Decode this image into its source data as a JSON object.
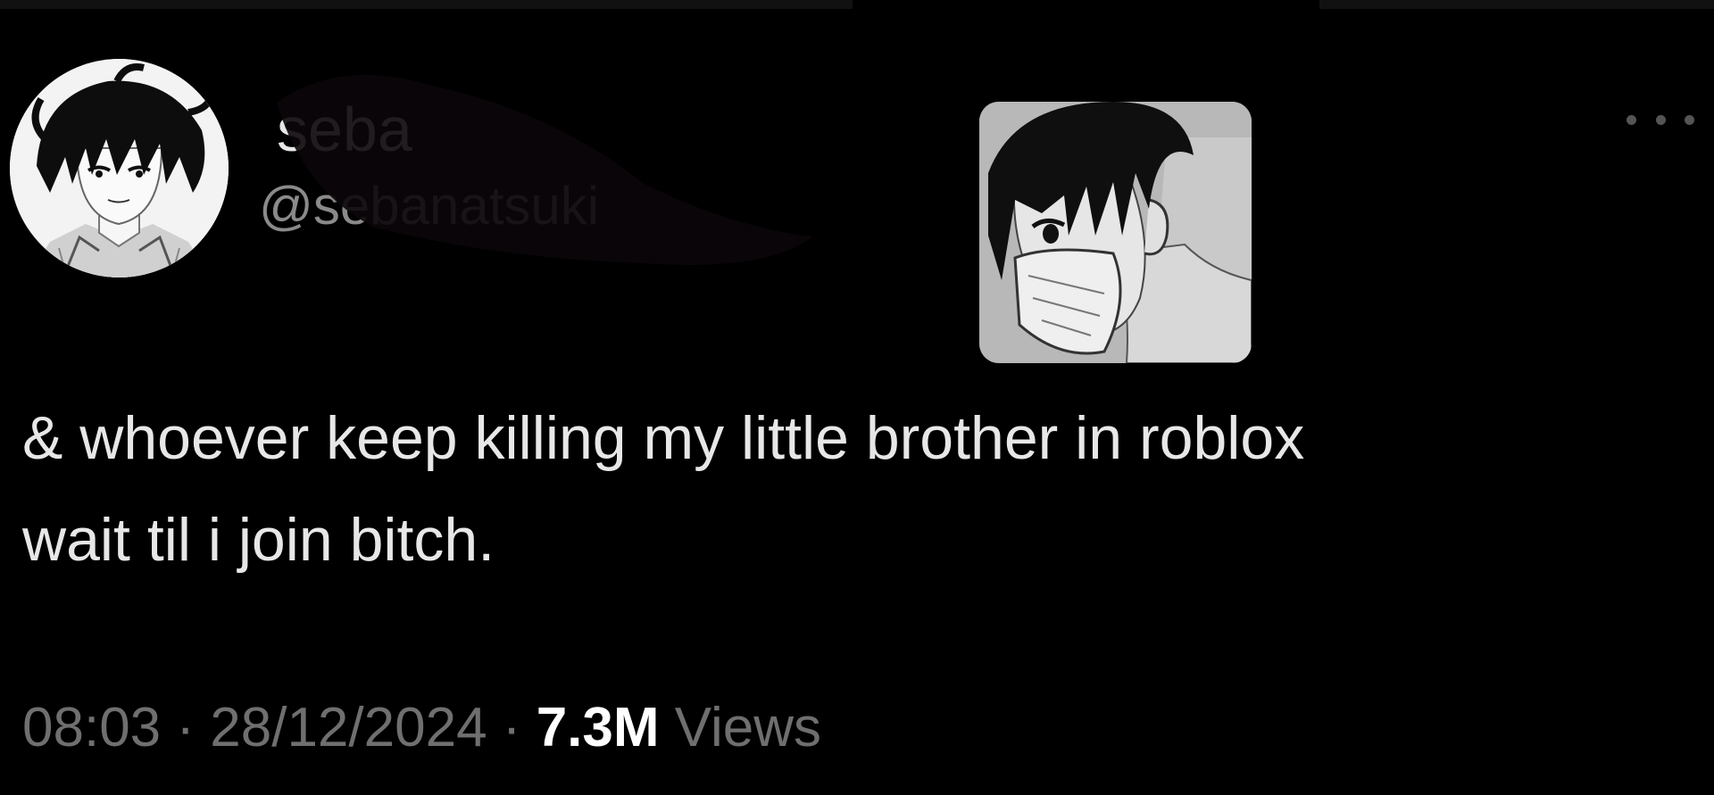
{
  "tweet": {
    "author": {
      "display_name": "seba",
      "handle": "@sebanatsuki"
    },
    "text": "& whoever keep killing my little brother in roblox\nwait til i join bitch.",
    "time": "08:03",
    "separator": " · ",
    "date": "28/12/2024",
    "views_count": "7.3M",
    "views_label": "Views"
  },
  "icons": {
    "more": "more-horizontal-icon"
  },
  "colors": {
    "background": "#000000",
    "primary_text": "#e7e7e7",
    "secondary_text": "#6f6f6f",
    "views_count": "#ffffff"
  }
}
